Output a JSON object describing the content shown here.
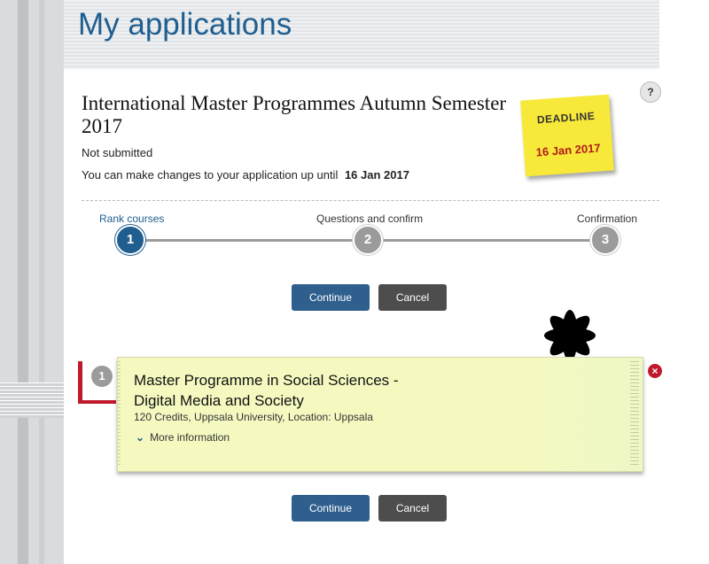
{
  "page_title": "My applications",
  "application": {
    "title": "International Master Programmes Autumn Semester 2017",
    "status": "Not submitted",
    "changes_text": "You can make changes to your application up until",
    "changes_date": "16 Jan 2017",
    "help_label": "?"
  },
  "deadline": {
    "label": "DEADLINE",
    "date": "16 Jan 2017"
  },
  "steps": [
    {
      "label": "Rank courses",
      "number": "1",
      "active": true
    },
    {
      "label": "Questions and confirm",
      "number": "2",
      "active": false
    },
    {
      "label": "Confirmation",
      "number": "3",
      "active": false
    }
  ],
  "buttons": {
    "continue": "Continue",
    "cancel": "Cancel"
  },
  "course": {
    "rank": "1",
    "name_line1": "Master Programme in Social Sciences -",
    "name_line2": "Digital Media and Society",
    "meta": "120 Credits, Uppsala University, Location: Uppsala",
    "more_info": "More information",
    "remove_icon": "×"
  },
  "colors": {
    "brand_blue": "#1f5e8f",
    "button_primary": "#2e5f8d",
    "button_secondary": "#4d4d4d",
    "sticky_yellow": "#f7e93a",
    "deadline_red": "#b31b1b",
    "card_bg": "#f5f9c0",
    "rank_red": "#c0192d"
  }
}
